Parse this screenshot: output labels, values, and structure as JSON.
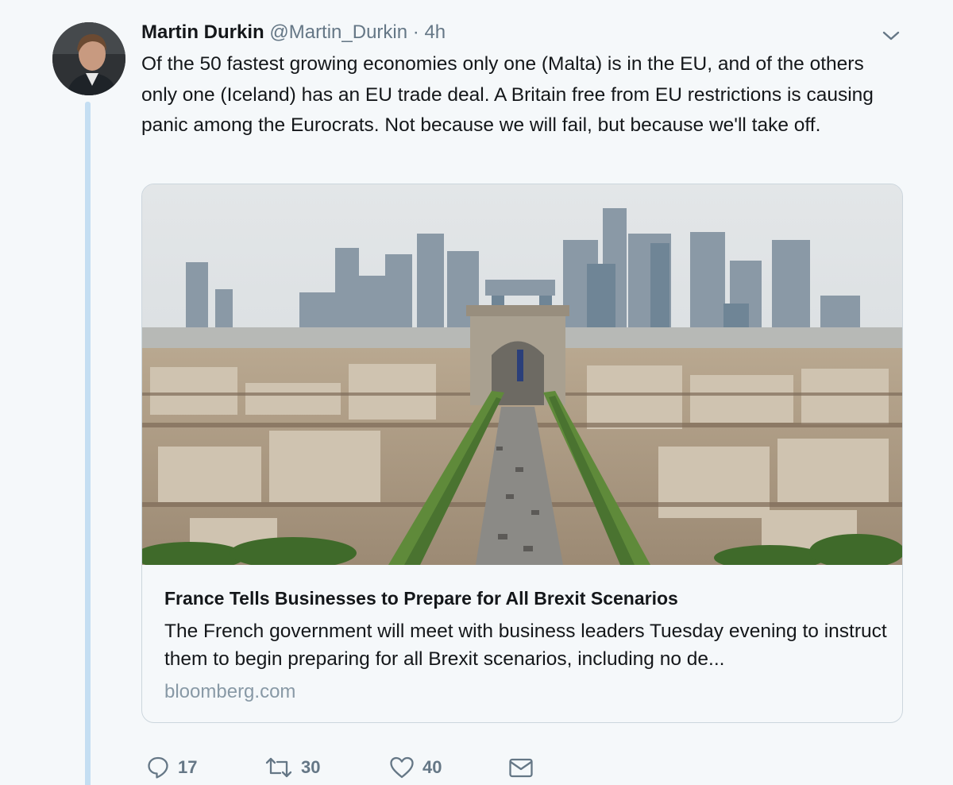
{
  "tweet": {
    "author_name": "Martin Durkin",
    "author_handle": "@Martin_Durkin",
    "separator": "·",
    "timestamp": "4h",
    "text": "Of the 50 fastest growing economies only one (Malta) is in the EU, and of the others only one (Iceland) has an EU trade deal. A Britain free from EU restrictions is causing panic among the Eurocrats. Not because we will fail, but because we'll take off."
  },
  "card": {
    "title": "France Tells Businesses to Prepare for All Brexit Scenarios",
    "description": "The French government will meet with business leaders Tuesday evening to instruct them to begin preparing for all Brexit scenarios, including no de...",
    "domain": "bloomberg.com"
  },
  "actions": {
    "replies": "17",
    "retweets": "30",
    "likes": "40"
  },
  "icons": {
    "caret": "chevron-down-icon",
    "reply": "speech-bubble-icon",
    "retweet": "retweet-arrows-icon",
    "like": "heart-icon",
    "dm": "envelope-icon"
  },
  "colors": {
    "background": "#f5f8fa",
    "text": "#14171a",
    "secondary": "#657786",
    "domain": "#8899a6",
    "thread_line": "#c4def2",
    "border": "#ccd6dd"
  }
}
